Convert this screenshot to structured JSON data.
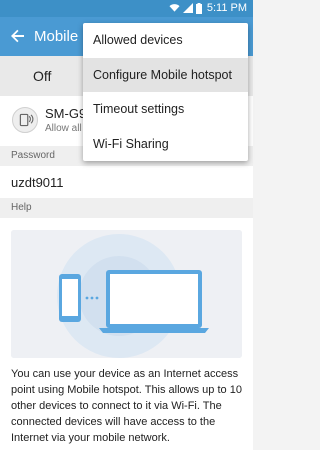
{
  "status_bar": {
    "time": "5:11 PM",
    "icons": [
      "wifi-icon",
      "signal-icon",
      "battery-icon"
    ]
  },
  "app_bar": {
    "title": "Mobile hotspot",
    "back_icon": "back-arrow-icon"
  },
  "toggle": {
    "label": "Off"
  },
  "device": {
    "name": "SM-G9",
    "subtitle": "Allow all",
    "icon": "hotspot-device-icon"
  },
  "password_section": {
    "header": "Password",
    "value": "uzdt9011"
  },
  "help_section": {
    "header": "Help",
    "text": "You can use your device as an Internet access point using Mobile hotspot. This allows up to 10 other devices to connect to it via Wi-Fi. The connected devices will have access to the Internet via your mobile network."
  },
  "menu": {
    "items": [
      {
        "label": "Allowed devices"
      },
      {
        "label": "Configure Mobile hotspot"
      },
      {
        "label": "Timeout settings"
      },
      {
        "label": "Wi-Fi Sharing"
      }
    ],
    "highlighted_index": 1
  },
  "colors": {
    "status_bar": "#3d90c7",
    "app_bar": "#4a9ad3",
    "accent": "#4a9ad3"
  }
}
